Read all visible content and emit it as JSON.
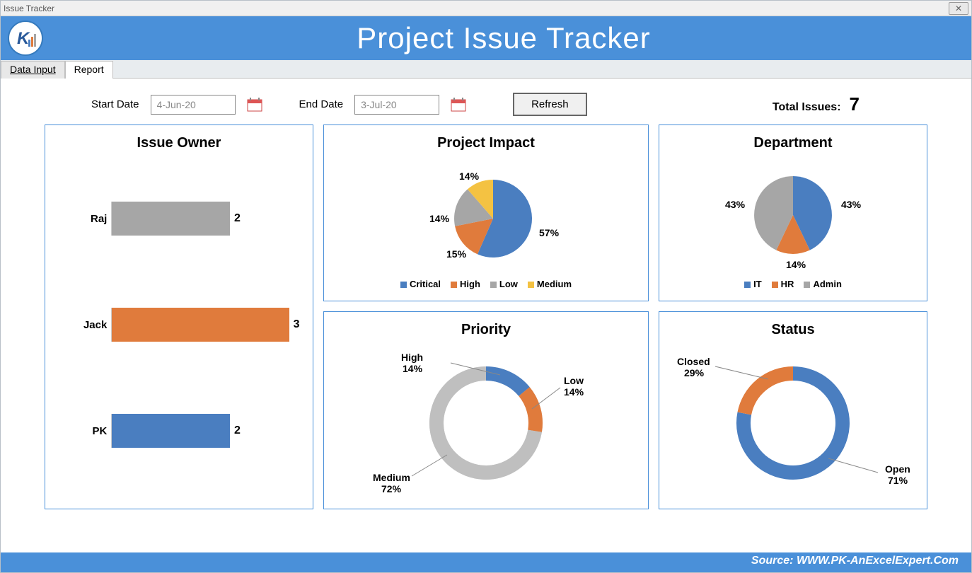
{
  "window_title": "Issue Tracker",
  "banner_title": "Project Issue Tracker",
  "tabs": [
    "Data Input",
    "Report"
  ],
  "filters": {
    "start_label": "Start Date",
    "start_value": "4-Jun-20",
    "end_label": "End Date",
    "end_value": "3-Jul-20",
    "refresh": "Refresh",
    "total_label": "Total Issues:",
    "total_value": "7"
  },
  "cards": {
    "impact_title": "Project Impact",
    "owner_title": "Issue Owner",
    "dept_title": "Department",
    "priority_title": "Priority",
    "status_title": "Status"
  },
  "legends": {
    "impact": [
      "Critical",
      "High",
      "Low",
      "Medium"
    ],
    "dept": [
      "IT",
      "HR",
      "Admin"
    ]
  },
  "colors": {
    "blue": "#4a7ec0",
    "orange": "#e07b3c",
    "grey": "#a6a6a6",
    "yellow": "#f4c242",
    "lblue": "#5b9bd5"
  },
  "footer": "Source: WWW.PK-AnExcelExpert.Com",
  "chart_data": [
    {
      "type": "pie",
      "title": "Project Impact",
      "series": [
        {
          "name": "Critical",
          "value": 57
        },
        {
          "name": "High",
          "value": 15
        },
        {
          "name": "Low",
          "value": 14
        },
        {
          "name": "Medium",
          "value": 14
        }
      ],
      "labels_pct": [
        "57%",
        "15%",
        "14%",
        "14%"
      ]
    },
    {
      "type": "bar",
      "title": "Issue Owner",
      "orientation": "horizontal",
      "categories": [
        "Raj",
        "Jack",
        "PK"
      ],
      "values": [
        2,
        3,
        2
      ],
      "xlim": [
        0,
        3
      ]
    },
    {
      "type": "pie",
      "title": "Department",
      "series": [
        {
          "name": "IT",
          "value": 43
        },
        {
          "name": "HR",
          "value": 14
        },
        {
          "name": "Admin",
          "value": 43
        }
      ],
      "labels_pct": [
        "43%",
        "14%",
        "43%"
      ]
    },
    {
      "type": "donut",
      "title": "Priority",
      "series": [
        {
          "name": "High",
          "value": 14
        },
        {
          "name": "Low",
          "value": 14
        },
        {
          "name": "Medium",
          "value": 72
        }
      ],
      "labels": [
        "High 14%",
        "Low 14%",
        "Medium 72%"
      ]
    },
    {
      "type": "donut",
      "title": "Status",
      "series": [
        {
          "name": "Open",
          "value": 71
        },
        {
          "name": "Closed",
          "value": 29
        }
      ],
      "labels": [
        "Open 71%",
        "Closed 29%"
      ]
    }
  ]
}
